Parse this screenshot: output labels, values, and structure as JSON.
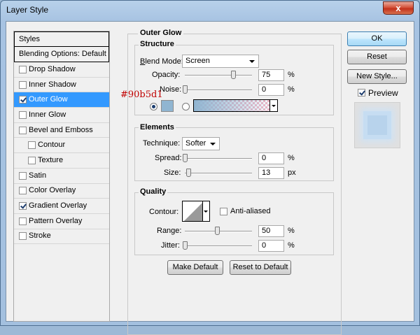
{
  "window": {
    "title": "Layer Style",
    "close_label": "x"
  },
  "styles_list": {
    "header": "Styles",
    "blending": "Blending Options: Default",
    "items": [
      {
        "label": "Drop Shadow",
        "checked": false,
        "indent": false
      },
      {
        "label": "Inner Shadow",
        "checked": false,
        "indent": false
      },
      {
        "label": "Outer Glow",
        "checked": true,
        "indent": false,
        "selected": true
      },
      {
        "label": "Inner Glow",
        "checked": false,
        "indent": false
      },
      {
        "label": "Bevel and Emboss",
        "checked": false,
        "indent": false
      },
      {
        "label": "Contour",
        "checked": false,
        "indent": true
      },
      {
        "label": "Texture",
        "checked": false,
        "indent": true
      },
      {
        "label": "Satin",
        "checked": false,
        "indent": false
      },
      {
        "label": "Color Overlay",
        "checked": false,
        "indent": false
      },
      {
        "label": "Gradient Overlay",
        "checked": true,
        "indent": false
      },
      {
        "label": "Pattern Overlay",
        "checked": false,
        "indent": false
      },
      {
        "label": "Stroke",
        "checked": false,
        "indent": false
      }
    ]
  },
  "outer_glow": {
    "title": "Outer Glow",
    "structure": {
      "title": "Structure",
      "blend_mode_label": "Blend Mode:",
      "blend_mode_value": "Screen",
      "opacity_label": "Opacity:",
      "opacity_value": "75",
      "opacity_unit": "%",
      "opacity_level": 0.75,
      "noise_label": "Noise:",
      "noise_value": "0",
      "noise_unit": "%",
      "noise_level": 0,
      "glow_color": "#90b5d1",
      "color_annotation": "#90b5d1"
    },
    "elements": {
      "title": "Elements",
      "technique_label": "Technique:",
      "technique_value": "Softer",
      "spread_label": "Spread:",
      "spread_value": "0",
      "spread_unit": "%",
      "spread_level": 0,
      "size_label": "Size:",
      "size_value": "13",
      "size_unit": "px",
      "size_level": 0.05
    },
    "quality": {
      "title": "Quality",
      "contour_label": "Contour:",
      "anti_aliased_label": "Anti-aliased",
      "range_label": "Range:",
      "range_value": "50",
      "range_unit": "%",
      "range_level": 0.5,
      "jitter_label": "Jitter:",
      "jitter_value": "0",
      "jitter_unit": "%",
      "jitter_level": 0
    },
    "make_default": "Make Default",
    "reset_default": "Reset to Default"
  },
  "actions": {
    "ok": "OK",
    "reset": "Reset",
    "new_style": "New Style...",
    "preview_label": "Preview",
    "preview_checked": true
  }
}
